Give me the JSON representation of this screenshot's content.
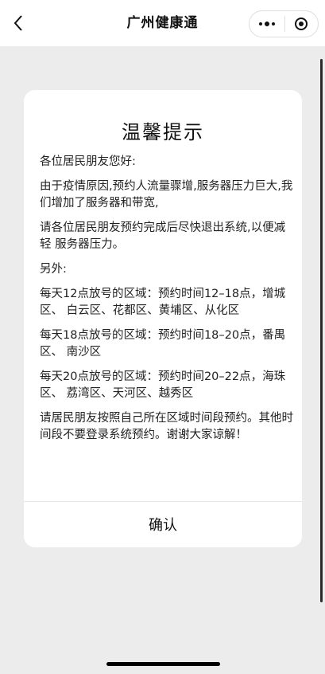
{
  "header": {
    "title": "广州健康通",
    "back_icon": "chevron-left-icon",
    "more_icon": "more-dots-icon",
    "close_icon": "target-close-icon"
  },
  "dialog": {
    "title": "温馨提示",
    "paragraphs": [
      "各位居民朋友您好:",
      "由于疫情原因,预约人流量骤增,服务器压力巨大,我们增加了服务器和带宽,",
      "请各位居民朋友预约完成后尽快退出系统,以便减轻 服务器压力。",
      "另外:",
      "每天12点放号的区域：预约时间12–18点，增城区、 白云区、花都区、黄埔区、从化区",
      "每天18点放号的区域：预约时间18–20点，番禺区、 南沙区",
      "每天20点放号的区域：预约时间20–22点，海珠区、 荔湾区、天河区、越秀区",
      "请居民朋友按照自己所在区域时间段预约。其他时间段不要登录系统预约。谢谢大家谅解！"
    ],
    "confirm_label": "确认"
  }
}
